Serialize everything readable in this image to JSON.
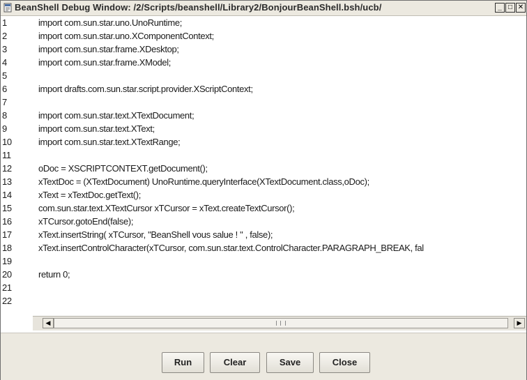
{
  "window": {
    "title": "BeanShell Debug Window: /2/Scripts/beanshell/Library2/BonjourBeanShell.bsh/ucb/",
    "controls": {
      "minimize": "_",
      "maximize": "□",
      "close": "✕"
    }
  },
  "editor": {
    "lines": [
      {
        "n": "1",
        "code": "import com.sun.star.uno.UnoRuntime;"
      },
      {
        "n": "2",
        "code": "import com.sun.star.uno.XComponentContext;"
      },
      {
        "n": "3",
        "code": "import com.sun.star.frame.XDesktop;"
      },
      {
        "n": "4",
        "code": "import com.sun.star.frame.XModel;"
      },
      {
        "n": "5",
        "code": ""
      },
      {
        "n": "6",
        "code": "import drafts.com.sun.star.script.provider.XScriptContext;"
      },
      {
        "n": "7",
        "code": ""
      },
      {
        "n": "8",
        "code": "import com.sun.star.text.XTextDocument;"
      },
      {
        "n": "9",
        "code": "import com.sun.star.text.XText;"
      },
      {
        "n": "10",
        "code": "import com.sun.star.text.XTextRange;"
      },
      {
        "n": "11",
        "code": ""
      },
      {
        "n": "12",
        "code": "oDoc = XSCRIPTCONTEXT.getDocument();"
      },
      {
        "n": "13",
        "code": "xTextDoc = (XTextDocument) UnoRuntime.queryInterface(XTextDocument.class,oDoc);"
      },
      {
        "n": "14",
        "code": "xText = xTextDoc.getText();"
      },
      {
        "n": "15",
        "code": "com.sun.star.text.XTextCursor xTCursor = xText.createTextCursor();"
      },
      {
        "n": "16",
        "code": "xTCursor.gotoEnd(false);"
      },
      {
        "n": "17",
        "code": "xText.insertString( xTCursor, \"BeanShell vous salue ! \" , false);"
      },
      {
        "n": "18",
        "code": "xText.insertControlCharacter(xTCursor, com.sun.star.text.ControlCharacter.PARAGRAPH_BREAK, fal"
      },
      {
        "n": "19",
        "code": ""
      },
      {
        "n": "20",
        "code": "return 0;"
      },
      {
        "n": "21",
        "code": ""
      },
      {
        "n": "22",
        "code": ""
      }
    ]
  },
  "scrollbar": {
    "left_arrow": "◀",
    "right_arrow": "▶"
  },
  "buttons": {
    "run": "Run",
    "clear": "Clear",
    "save": "Save",
    "close": "Close"
  },
  "icons": {
    "window_icon": "document-icon"
  }
}
